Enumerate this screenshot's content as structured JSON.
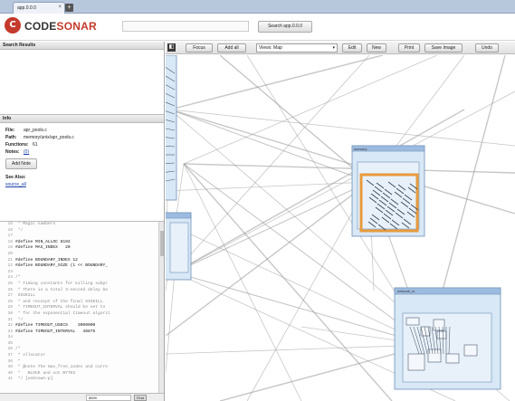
{
  "browser": {
    "tab_title": "app.0.0.0",
    "tab_close": "×",
    "new_tab": "+"
  },
  "header": {
    "logo_mark": "C",
    "brand_plain": "CODE",
    "brand_accent": "SONAR",
    "search_value": "",
    "search_button": "Search app.0.0.0"
  },
  "search_results": {
    "title": "Search Results"
  },
  "info": {
    "title": "Info",
    "file_label": "File:",
    "file_value": "apr_pools.c",
    "path_label": "Path:",
    "path_value": "memory/unix/apr_pools.c",
    "functions_label": "Functions:",
    "functions_value": "61",
    "notes_label": "Notes:",
    "notes_value": "(0)",
    "add_note": "Add Note",
    "see_also_label": "See Also:",
    "see_also_link": "source_all"
  },
  "code": {
    "lines": [
      {
        "n": "15",
        "t": " * Magic numbers",
        "kind": "cm"
      },
      {
        "n": "16",
        "t": " */",
        "kind": "cm"
      },
      {
        "n": "17",
        "t": "",
        "kind": "cm"
      },
      {
        "n": "18",
        "t": "#define MIN_ALLOC 8192",
        "kind": "pp"
      },
      {
        "n": "19",
        "t": "#define MAX_INDEX   20",
        "kind": "pp"
      },
      {
        "n": "20",
        "t": "",
        "kind": "pp"
      },
      {
        "n": "21",
        "t": "#define BOUNDARY_INDEX 12",
        "kind": "pp"
      },
      {
        "n": "22",
        "t": "#define BOUNDARY_SIZE (1 << BOUNDARY_",
        "kind": "pp"
      },
      {
        "n": "23",
        "t": "",
        "kind": "pp"
      },
      {
        "n": "24",
        "t": "/*",
        "kind": "cm"
      },
      {
        "n": "25",
        "t": " * Timing constants for killing subpr",
        "kind": "cm"
      },
      {
        "n": "26",
        "t": " * There is a total 3-second delay be",
        "kind": "cm"
      },
      {
        "n": "27",
        "t": " SIGKILL",
        "kind": "cm"
      },
      {
        "n": "28",
        "t": " * and receipt of the final SIGKILL.",
        "kind": "cm"
      },
      {
        "n": "29",
        "t": " * TIMEOUT_INTERVAL should be set to",
        "kind": "cm"
      },
      {
        "n": "30",
        "t": " * for the exponential timeout algorit",
        "kind": "cm"
      },
      {
        "n": "31",
        "t": " */",
        "kind": "cm"
      },
      {
        "n": "32",
        "t": "#define TIMEOUT_USECS    3000000",
        "kind": "pp"
      },
      {
        "n": "33",
        "t": "#define TIMEOUT_INTERVAL   46875",
        "kind": "pp"
      },
      {
        "n": "34",
        "t": "",
        "kind": "pp"
      },
      {
        "n": "35",
        "t": "",
        "kind": "pp"
      },
      {
        "n": "36",
        "t": "/*",
        "kind": "cm"
      },
      {
        "n": "37",
        "t": " * Allocator",
        "kind": "cm"
      },
      {
        "n": "38",
        "t": " *",
        "kind": "cm"
      },
      {
        "n": "39",
        "t": " * @note The max_free_index and curre",
        "kind": "cm"
      },
      {
        "n": "40",
        "t": " *   BLOCK and not BYTES",
        "kind": "cm"
      },
      {
        "n": "41",
        "t": " */ [unknown-p]",
        "kind": "cm"
      }
    ],
    "find_value": "8899",
    "find_button": "Find"
  },
  "toolbar": {
    "toggle": "◧",
    "focus": "Focus",
    "add_all": "Add all",
    "views_label": "Views:",
    "views_value": "Map",
    "edit": "Edit",
    "new": "New",
    "print": "Print",
    "save_image": "Save Image",
    "undo": "Undo"
  },
  "graph": {
    "clusters": [
      {
        "id": "cluster-top-left",
        "label": ""
      },
      {
        "id": "cluster-left-mid",
        "label": ""
      },
      {
        "id": "cluster-center",
        "label": "memory"
      },
      {
        "id": "cluster-lower-right",
        "label": "network_io"
      }
    ],
    "colors": {
      "cluster_fill": "#d8e8f6",
      "cluster_stroke": "#6f8fb5",
      "selected": "#e79a3c",
      "edge": "#9a9a9a"
    }
  }
}
